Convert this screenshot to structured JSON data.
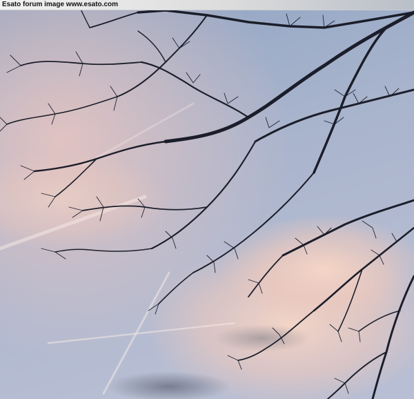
{
  "watermark": {
    "text": "Esato forum image www.esato.com"
  },
  "colors": {
    "sky_top": "#97a8c4",
    "sky_mid": "#a9b4cd",
    "sky_bottom": "#b5bdd3",
    "cloud_pink": "#f1cdbf",
    "cloud_warm": "#e8c2b6",
    "branch": "#1b1e2a",
    "dark_cloud": "#6f7484"
  }
}
